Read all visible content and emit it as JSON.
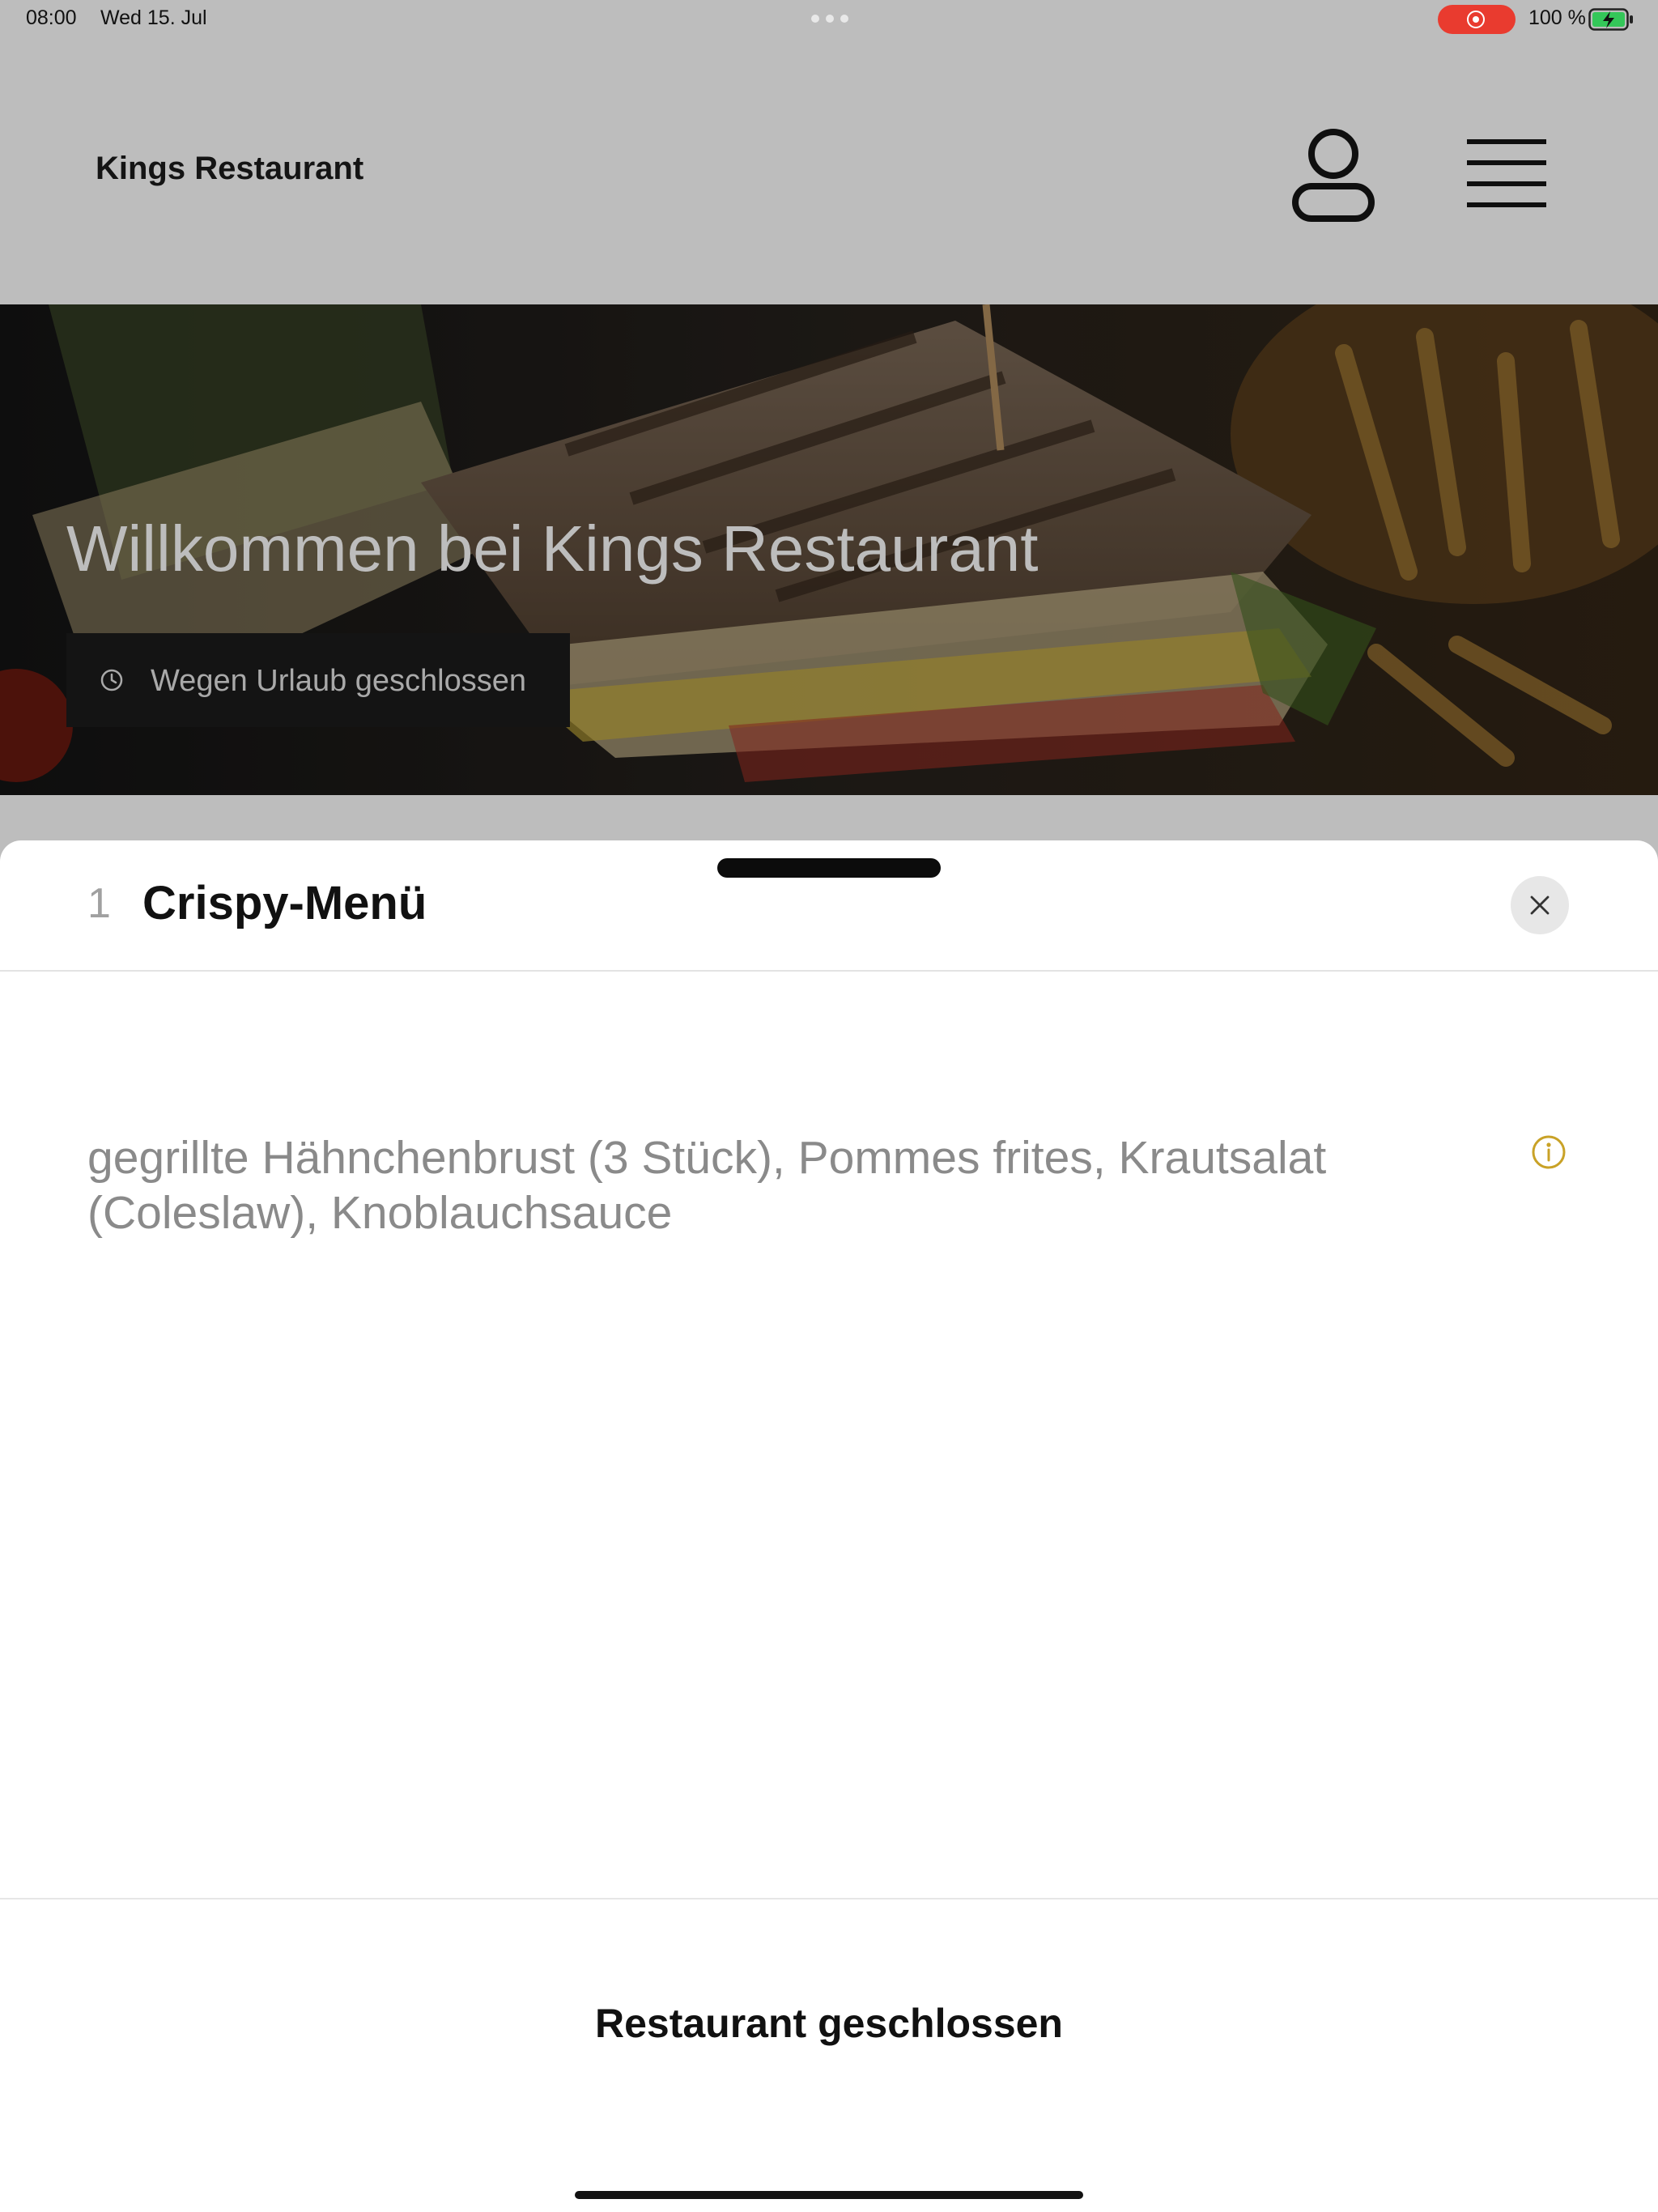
{
  "status_bar": {
    "time": "08:00",
    "date": "Wed 15. Jul",
    "battery": "100 %"
  },
  "header": {
    "brand": "Kings Restaurant",
    "account_icon": "user-icon",
    "menu_icon": "hamburger-menu-icon"
  },
  "hero": {
    "title": "Willkommen bei Kings Restaurant",
    "status_badge": "Wegen Urlaub geschlossen",
    "status_icon": "clock-icon"
  },
  "item_sheet": {
    "quantity": "1",
    "title": "Crispy-Menü",
    "description": "gegrillte Hähnchenbrust (3 Stück), Pommes frites, Krautsalat (Coleslaw), Knoblauchsauce",
    "info_icon": "info-icon",
    "close_icon": "close-icon",
    "footer_label": "Restaurant geschlossen"
  },
  "colors": {
    "header_bg": "#bdbdbd",
    "accent_info": "#c9a227",
    "recording": "#e93b2f",
    "battery_green": "#34c759"
  }
}
